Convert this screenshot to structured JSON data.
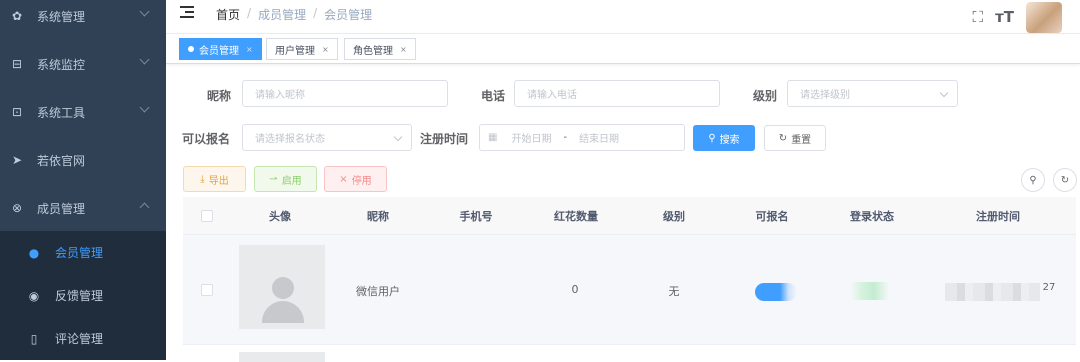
{
  "sidebar": {
    "items": [
      {
        "label": "系统管理",
        "icon": "gear-icon",
        "glyph": "✿"
      },
      {
        "label": "系统监控",
        "icon": "monitor-icon",
        "glyph": "⊟"
      },
      {
        "label": "系统工具",
        "icon": "toolbox-icon",
        "glyph": "⊡"
      },
      {
        "label": "若依官网",
        "icon": "send-icon",
        "glyph": "➤"
      },
      {
        "label": "成员管理",
        "icon": "members-icon",
        "glyph": "⊗"
      }
    ],
    "subitems": [
      {
        "label": "会员管理",
        "icon": "user-icon",
        "glyph": "●"
      },
      {
        "label": "反馈管理",
        "icon": "eye-icon",
        "glyph": "◉"
      },
      {
        "label": "评论管理",
        "icon": "book-icon",
        "glyph": "▯"
      }
    ]
  },
  "navbar": {
    "breadcrumb": {
      "home": "首页",
      "parent": "成员管理",
      "current": "会员管理",
      "sep": "/"
    },
    "fullscreen_glyph": "⛶",
    "fontsize_glyph": "тT"
  },
  "tags": [
    {
      "label": "会员管理",
      "active": true
    },
    {
      "label": "用户管理",
      "active": false
    },
    {
      "label": "角色管理",
      "active": false
    }
  ],
  "tag_close": "×",
  "search": {
    "nickname_label": "昵称",
    "nickname_placeholder": "请输入昵称",
    "phone_label": "电话",
    "phone_placeholder": "请输入电话",
    "level_label": "级别",
    "level_placeholder": "请选择级别",
    "signup_label": "可以报名",
    "signup_placeholder": "请选择报名状态",
    "regtime_label": "注册时间",
    "start_placeholder": "开始日期",
    "range_sep": "-",
    "end_placeholder": "结束日期",
    "search_btn": "搜索",
    "reset_btn": "重置"
  },
  "toolbar": {
    "export": "导出",
    "enable": "启用",
    "disable": "停用"
  },
  "table": {
    "headers": [
      "头像",
      "昵称",
      "手机号",
      "红花数量",
      "级别",
      "可报名",
      "登录状态",
      "注册时间"
    ],
    "rows": [
      {
        "nickname": "微信用户",
        "phone": "",
        "flowers": "0",
        "level": "无",
        "regtime_suffix": "27"
      }
    ]
  },
  "colors": {
    "primary": "#409eff",
    "sidebar": "#304156",
    "submenu": "#1f2d3d"
  }
}
